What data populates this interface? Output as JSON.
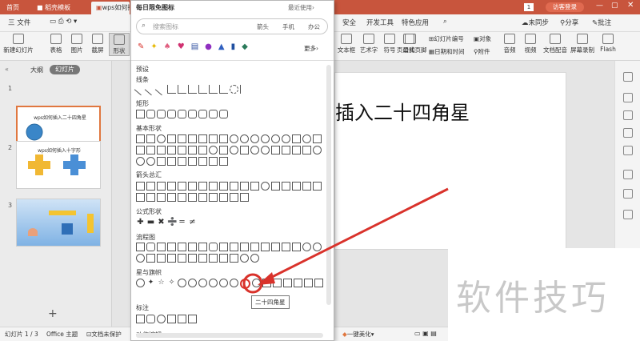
{
  "tabs": {
    "home": "首页",
    "template": "稻壳模板",
    "doc": "wps如何插"
  },
  "topright": {
    "page_badge": "1",
    "login_button": "访客登录"
  },
  "menubar": {
    "file": "三 文件",
    "items": [
      "安全",
      "开发工具",
      "特色应用"
    ],
    "right_items": [
      "未同步",
      "分享",
      "批注"
    ]
  },
  "ribbon": {
    "left": [
      "新建幻灯片",
      "表格",
      "图片",
      "截屏",
      "形状"
    ],
    "right": [
      "文本框",
      "艺术字",
      "符号",
      "公式",
      "页眉和页脚",
      "幻灯片编号",
      "日期和时间",
      "对象",
      "附件",
      "音频",
      "视频",
      "文档配音",
      "屏幕录制",
      "Flash"
    ]
  },
  "leftpanel": {
    "tab_outline": "大纲",
    "tab_slides": "幻灯片",
    "slides": [
      {
        "num": "1",
        "title": "wps如何插入二十四角星"
      },
      {
        "num": "2",
        "title": "wps如何插入十字形"
      },
      {
        "num": "3",
        "title": ""
      }
    ],
    "add": "+"
  },
  "canvas": {
    "title_fragment": "插入二十四角星"
  },
  "dropdown": {
    "header": "每日限免图标",
    "recent": "最近使用",
    "search_placeholder": "搜索图标",
    "tags": [
      "箭头",
      "手机",
      "办公"
    ],
    "more": "更多",
    "preset": "预设",
    "sections": [
      "线条",
      "矩形",
      "基本形状",
      "箭头总汇",
      "公式形状",
      "流程图",
      "星与旗帜",
      "标注",
      "动作按钮"
    ],
    "tooltip": "二十四角星"
  },
  "statusbar": {
    "slide_info": "幻灯片 1 / 3",
    "theme": "Office 主题",
    "protect": "文档未保护",
    "beautify": "一键美化"
  },
  "watermark": "软件技巧",
  "colors": {
    "accent": "#c8553d",
    "arrow": "#d9322b",
    "selection": "#e0773f",
    "star": "#3a86c8"
  }
}
